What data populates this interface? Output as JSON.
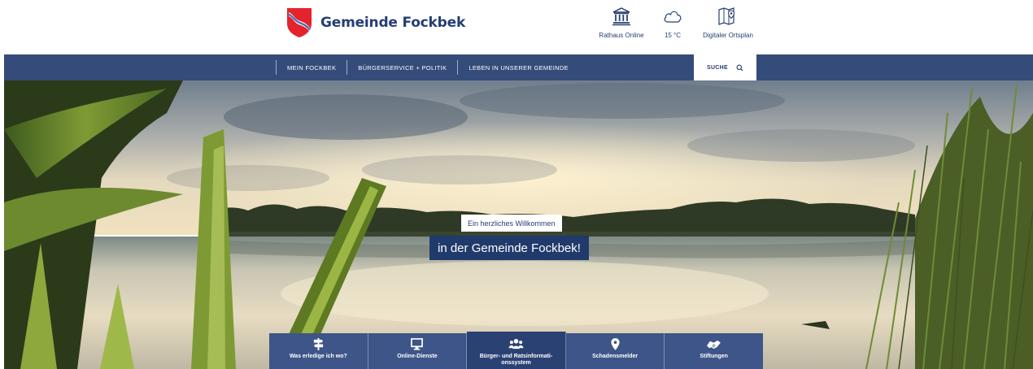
{
  "brand": {
    "name": "Gemeinde Fockbek",
    "coat_of_arms_colors": [
      "#e4232c",
      "#ffffff",
      "#4a6fb3"
    ]
  },
  "quick_links": [
    {
      "icon": "town-hall-icon",
      "label": "Rathaus Online"
    },
    {
      "icon": "cloud-icon",
      "label": "15 °C"
    },
    {
      "icon": "map-icon",
      "label": "Digitaler Ortsplan"
    }
  ],
  "nav": {
    "items": [
      {
        "label": "MEIN FOCKBEK"
      },
      {
        "label": "BÜRGERSERVICE + POLITIK"
      },
      {
        "label": "LEBEN IN UNSERER GEMEINDE"
      }
    ],
    "search": {
      "label": "SUCHE",
      "icon": "search-icon"
    }
  },
  "hero": {
    "kicker": "Ein herzliches Willkommen",
    "headline": "in der Gemeinde Fockbek!"
  },
  "services": [
    {
      "icon": "signpost-icon",
      "label": "Was erledige ich wo?"
    },
    {
      "icon": "monitor-icon",
      "label": "Online-Dienste"
    },
    {
      "icon": "users-icon",
      "label": "Bürger- und Ratsinformati-onssystem"
    },
    {
      "icon": "map-marker-icon",
      "label": "Schadensmelder"
    },
    {
      "icon": "handshake-icon",
      "label": "Stiftungen"
    }
  ],
  "colors": {
    "brand_blue": "#253e73",
    "nav_blue": "#354b7a",
    "service_blue": "#3d5588"
  }
}
